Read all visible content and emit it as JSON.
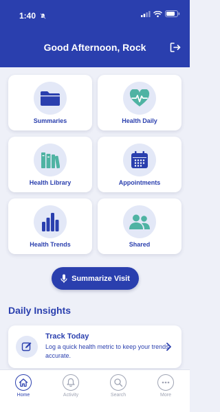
{
  "status_bar": {
    "time": "1:40"
  },
  "header": {
    "greeting": "Good Afternoon, Rock"
  },
  "tiles": [
    {
      "label": "Summaries",
      "icon": "folder-icon"
    },
    {
      "label": "Health Daily",
      "icon": "heart-pulse-icon"
    },
    {
      "label": "Health Library",
      "icon": "books-icon"
    },
    {
      "label": "Appointments",
      "icon": "calendar-icon"
    },
    {
      "label": "Health Trends",
      "icon": "bar-chart-icon"
    },
    {
      "label": "Shared",
      "icon": "people-icon"
    }
  ],
  "summarize_button": {
    "label": "Summarize Visit"
  },
  "daily_insights": {
    "title": "Daily Insights",
    "card": {
      "title": "Track Today",
      "description": "Log a quick health metric to keep your trends accurate."
    }
  },
  "tab_bar": {
    "tabs": [
      {
        "label": "Home",
        "active": true
      },
      {
        "label": "Activity",
        "active": false
      },
      {
        "label": "Search",
        "active": false
      },
      {
        "label": "More",
        "active": false
      }
    ]
  },
  "colors": {
    "primary": "#2a3fae",
    "teal": "#4fb3a3",
    "background": "#eef0f8"
  }
}
